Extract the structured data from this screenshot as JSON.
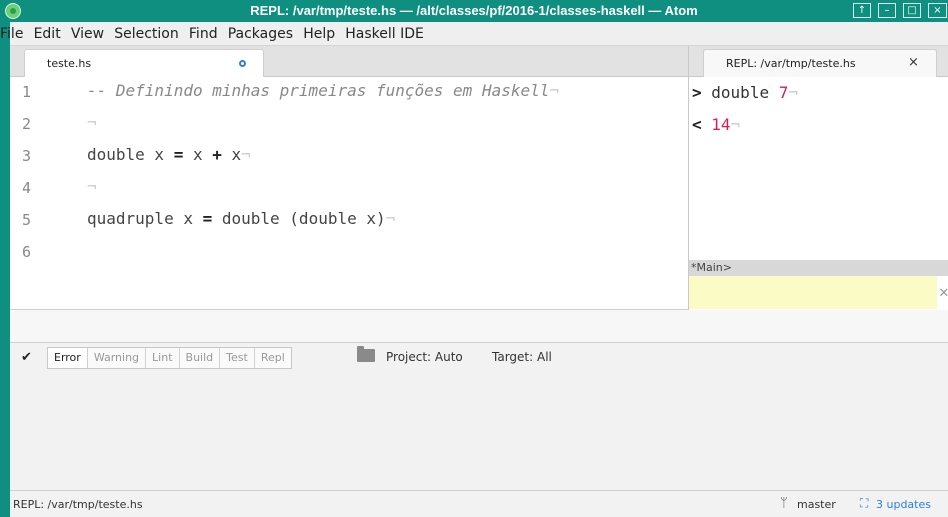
{
  "window": {
    "title": "REPL: /var/tmp/teste.hs — /alt/classes/pf/2016-1/classes-haskell — Atom",
    "controls": {
      "up": "↑",
      "minimize": "–",
      "maximize": "□",
      "close": "×"
    }
  },
  "menu": {
    "items": [
      "File",
      "Edit",
      "View",
      "Selection",
      "Find",
      "Packages",
      "Help",
      "Haskell IDE"
    ]
  },
  "editor_tab": {
    "title": "teste.hs",
    "modified": true
  },
  "repl_tab": {
    "title": "REPL: /var/tmp/teste.hs",
    "close": "×"
  },
  "editor": {
    "lines": [
      {
        "number": "1",
        "text": "-- Definindo minhas primeiras funções em Haskell"
      },
      {
        "number": "2",
        "text": ""
      },
      {
        "number": "3",
        "text": "double x = x + x"
      },
      {
        "number": "4",
        "text": ""
      },
      {
        "number": "5",
        "text": "quadruple x = double (double x)"
      },
      {
        "number": "6",
        "text": ""
      }
    ],
    "eol_marker": "¬"
  },
  "repl": {
    "lines": [
      {
        "mark": ">",
        "text": "double",
        "value": "7"
      },
      {
        "mark": "<",
        "text": "",
        "value": "14"
      }
    ],
    "prompt": "*Main>",
    "input_value": ""
  },
  "panel": {
    "tabs": [
      "Error",
      "Warning",
      "Lint",
      "Build",
      "Test",
      "Repl"
    ],
    "active_tab": "Error",
    "project": "Project: Auto",
    "target": "Target: All"
  },
  "status": {
    "path": "REPL: /var/tmp/teste.hs",
    "branch": "master",
    "updates": "3 updates"
  },
  "colors": {
    "titlebar": "#0f8f80",
    "repl_input_bg": "#fbfbc6",
    "number": "#d81b60",
    "link": "#2f80d8"
  }
}
